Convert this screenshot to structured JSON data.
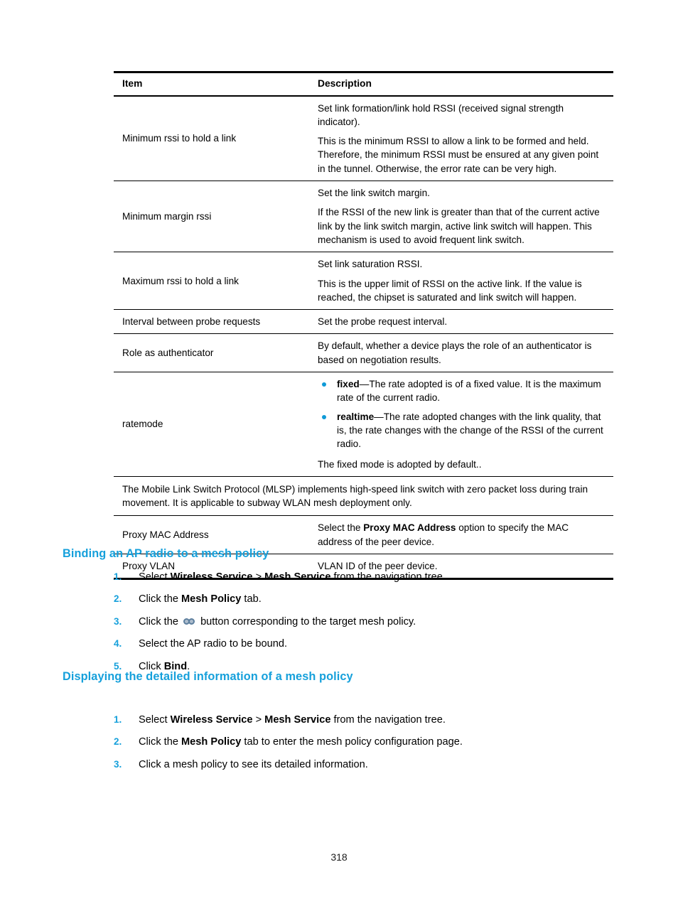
{
  "table": {
    "headers": {
      "item": "Item",
      "description": "Description"
    },
    "rows": [
      {
        "item": "Minimum rssi to hold a link",
        "paragraphs": [
          "Set link formation/link hold RSSI (received signal strength indicator).",
          "This is the minimum RSSI to allow a link to be formed and held. Therefore, the minimum RSSI must be ensured at any given point in the tunnel. Otherwise, the error rate can be very high."
        ]
      },
      {
        "item": "Minimum margin rssi",
        "paragraphs": [
          "Set the link switch margin.",
          "If the RSSI of the new link is greater than that of the current active link by the link switch margin, active link switch will happen. This mechanism is used to avoid frequent link switch."
        ]
      },
      {
        "item": "Maximum rssi to hold a link",
        "paragraphs": [
          "Set link saturation RSSI.",
          "This is the upper limit of RSSI on the active link. If the value is reached, the chipset is saturated and link switch will happen."
        ]
      },
      {
        "item": "Interval between probe requests",
        "paragraphs": [
          "Set the probe request interval."
        ]
      },
      {
        "item": "Role as authenticator",
        "paragraphs": [
          "By default, whether a device plays the role of an authenticator is based on negotiation results."
        ]
      },
      {
        "item": "ratemode",
        "bullets": [
          {
            "term": "fixed",
            "dash": "—",
            "text": "The rate adopted is of a fixed value. It is the maximum rate of the current radio."
          },
          {
            "term": "realtime",
            "dash": "—",
            "text": "The rate adopted changes with the link quality, that is, the rate changes with the change of the RSSI of the current radio."
          }
        ],
        "paragraphs": [
          "The fixed mode is adopted by default.."
        ]
      },
      {
        "full_span": "The Mobile Link Switch Protocol (MLSP) implements high-speed link switch with zero packet loss during train movement. It is applicable to subway WLAN mesh deployment only."
      },
      {
        "item": "Proxy MAC Address",
        "rich": {
          "pre": "Select the ",
          "bold": "Proxy MAC Address",
          "post": " option to specify the MAC address of the peer device."
        }
      },
      {
        "item": "Proxy VLAN",
        "paragraphs": [
          "VLAN ID of the peer device."
        ]
      }
    ]
  },
  "sections": [
    {
      "heading": "Binding an AP radio to a mesh policy",
      "steps": [
        {
          "num": "1.",
          "pre": "Select ",
          "bold1": "Wireless Service",
          "mid": " > ",
          "bold2": "Mesh Service",
          "post": " from the navigation tree."
        },
        {
          "num": "2.",
          "pre": "Click the ",
          "bold1": "Mesh Policy",
          "mid": "",
          "bold2": "",
          "post": " tab."
        },
        {
          "num": "3.",
          "pre": "Click the ",
          "icon": "link-icon",
          "post": " button corresponding to the target mesh policy."
        },
        {
          "num": "4.",
          "pre": "Select the AP radio to be bound.",
          "post": ""
        },
        {
          "num": "5.",
          "pre": "Click ",
          "bold1": "Bind",
          "post": "."
        }
      ]
    },
    {
      "heading": "Displaying the detailed information of a mesh policy",
      "steps": [
        {
          "num": "1.",
          "pre": "Select ",
          "bold1": "Wireless Service",
          "mid": " > ",
          "bold2": "Mesh Service",
          "post": " from the navigation tree."
        },
        {
          "num": "2.",
          "pre": "Click the ",
          "bold1": "Mesh Policy",
          "mid": "",
          "bold2": "",
          "post": " tab to enter the mesh policy configuration page."
        },
        {
          "num": "3.",
          "pre": "Click a mesh policy to see its detailed information.",
          "post": ""
        }
      ]
    }
  ],
  "footer": {
    "page_number": "318"
  },
  "colors": {
    "heading": "#16a0db",
    "list_number": "#16a0db",
    "bullet": "#0f9ad7",
    "text": "#000000",
    "rule": "#000000"
  }
}
